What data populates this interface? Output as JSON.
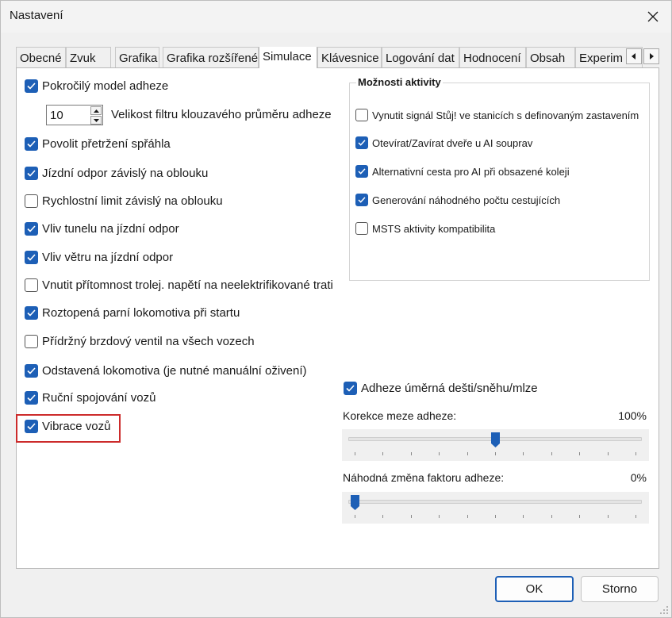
{
  "window": {
    "title": "Nastavení"
  },
  "tabs": [
    {
      "label": "Obecné"
    },
    {
      "label": "Zvuk"
    },
    {
      "label": "Grafika"
    },
    {
      "label": "Grafika rozšířené"
    },
    {
      "label": "Simulace",
      "active": true
    },
    {
      "label": "Klávesnice"
    },
    {
      "label": "Logování dat"
    },
    {
      "label": "Hodnocení"
    },
    {
      "label": "Obsah"
    },
    {
      "label": "Experim"
    }
  ],
  "left_options": [
    {
      "label": "Pokročilý model adheze",
      "checked": true
    },
    {
      "label": "Povolit přetržení spřáhla",
      "checked": true
    },
    {
      "label": "Jízdní odpor závislý na oblouku",
      "checked": true
    },
    {
      "label": "Rychlostní limit závislý na oblouku",
      "checked": false
    },
    {
      "label": "Vliv tunelu na jízdní odpor",
      "checked": true
    },
    {
      "label": "Vliv větru na jízdní odpor",
      "checked": true
    },
    {
      "label": "Vnutit přítomnost trolej. napětí na neelektrifikované trati",
      "checked": false
    },
    {
      "label": "Roztopená parní lokomotiva při startu",
      "checked": true
    },
    {
      "label": "Přídržný brzdový ventil na všech vozech",
      "checked": false
    },
    {
      "label": "Odstavená lokomotiva (je nutné manuální oživení)",
      "checked": true
    },
    {
      "label": "Ruční spojování vozů",
      "checked": true
    },
    {
      "label": "Vibrace vozů",
      "checked": true
    }
  ],
  "filter": {
    "value": "10",
    "label": "Velikost filtru klouzavého průměru adheze"
  },
  "activity": {
    "title": "Možnosti aktivity",
    "options": [
      {
        "label": "Vynutit signál Stůj! ve stanicích s definovaným zastavením",
        "checked": false
      },
      {
        "label": "Otevírat/Zavírat dveře u AI souprav",
        "checked": true
      },
      {
        "label": "Alternativní cesta pro AI při obsazené koleji",
        "checked": true
      },
      {
        "label": "Generování náhodného počtu cestujících",
        "checked": true
      },
      {
        "label": "MSTS aktivity kompatibilita",
        "checked": false
      }
    ]
  },
  "weather_adhesion": {
    "label": "Adheze úměrná dešti/sněhu/mlze",
    "checked": true
  },
  "slider1": {
    "label": "Korekce meze adheze:",
    "value_text": "100%",
    "position": 0.5
  },
  "slider2": {
    "label": "Náhodná změna faktoru adheze:",
    "value_text": "0%",
    "position": 0.0
  },
  "buttons": {
    "ok": "OK",
    "cancel": "Storno"
  },
  "colors": {
    "accent": "#1d5fb6",
    "highlight": "#cc2b2b"
  }
}
